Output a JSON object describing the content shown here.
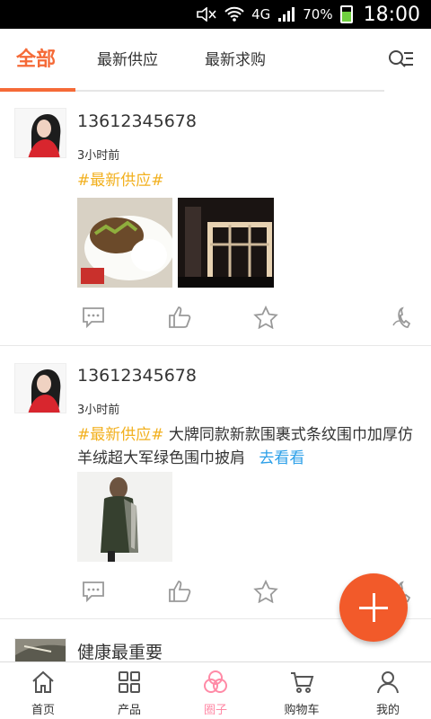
{
  "status_bar": {
    "network": "4G",
    "battery": "70%",
    "time": "18:00"
  },
  "tabs": [
    {
      "label": "全部",
      "active": true
    },
    {
      "label": "最新供应",
      "active": false
    },
    {
      "label": "最新求购",
      "active": false
    }
  ],
  "posts": [
    {
      "username": "13612345678",
      "time": "3小时前",
      "tag": "#最新供应#",
      "text": "",
      "more": ""
    },
    {
      "username": "13612345678",
      "time": "3小时前",
      "tag": "#最新供应#",
      "text": "大牌同款新款围裹式条纹围巾加厚仿羊绒超大军绿色围巾披肩",
      "more": "去看看"
    },
    {
      "username": "健康最重要"
    }
  ],
  "bottom_nav": [
    {
      "label": "首页",
      "icon": "home-icon"
    },
    {
      "label": "产品",
      "icon": "grid-icon"
    },
    {
      "label": "圈子",
      "icon": "circles-icon",
      "active": true
    },
    {
      "label": "购物车",
      "icon": "cart-icon"
    },
    {
      "label": "我的",
      "icon": "person-icon"
    }
  ],
  "colors": {
    "accent": "#f56a37",
    "tag": "#f2b01e",
    "link": "#2b9fe8",
    "fab": "#f25a2a",
    "nav_active": "#ff8aa6"
  }
}
